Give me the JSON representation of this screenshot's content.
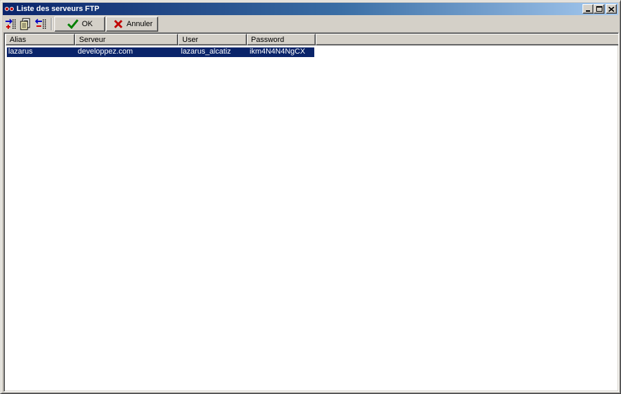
{
  "window": {
    "title": "Liste des serveurs FTP",
    "title_buttons": [
      "minimize-button",
      "maximize-button",
      "close-button"
    ]
  },
  "toolbar": {
    "icons": [
      "add-server-icon",
      "edit-server-icon",
      "remove-server-icon"
    ],
    "ok_label": "OK",
    "cancel_label": "Annuler"
  },
  "table": {
    "columns": [
      "Alias",
      "Serveur",
      "User",
      "Password"
    ],
    "rows": [
      {
        "alias": "lazarus",
        "server": "developpez.com",
        "user": "lazarus_alcatiz",
        "password": "ikm4N4N4NgCX",
        "selected": true
      }
    ]
  },
  "colors": {
    "title_gradient_start": "#0a246a",
    "title_gradient_end": "#a6caf0",
    "selection": "#0a246a",
    "face": "#d4d0c8"
  }
}
